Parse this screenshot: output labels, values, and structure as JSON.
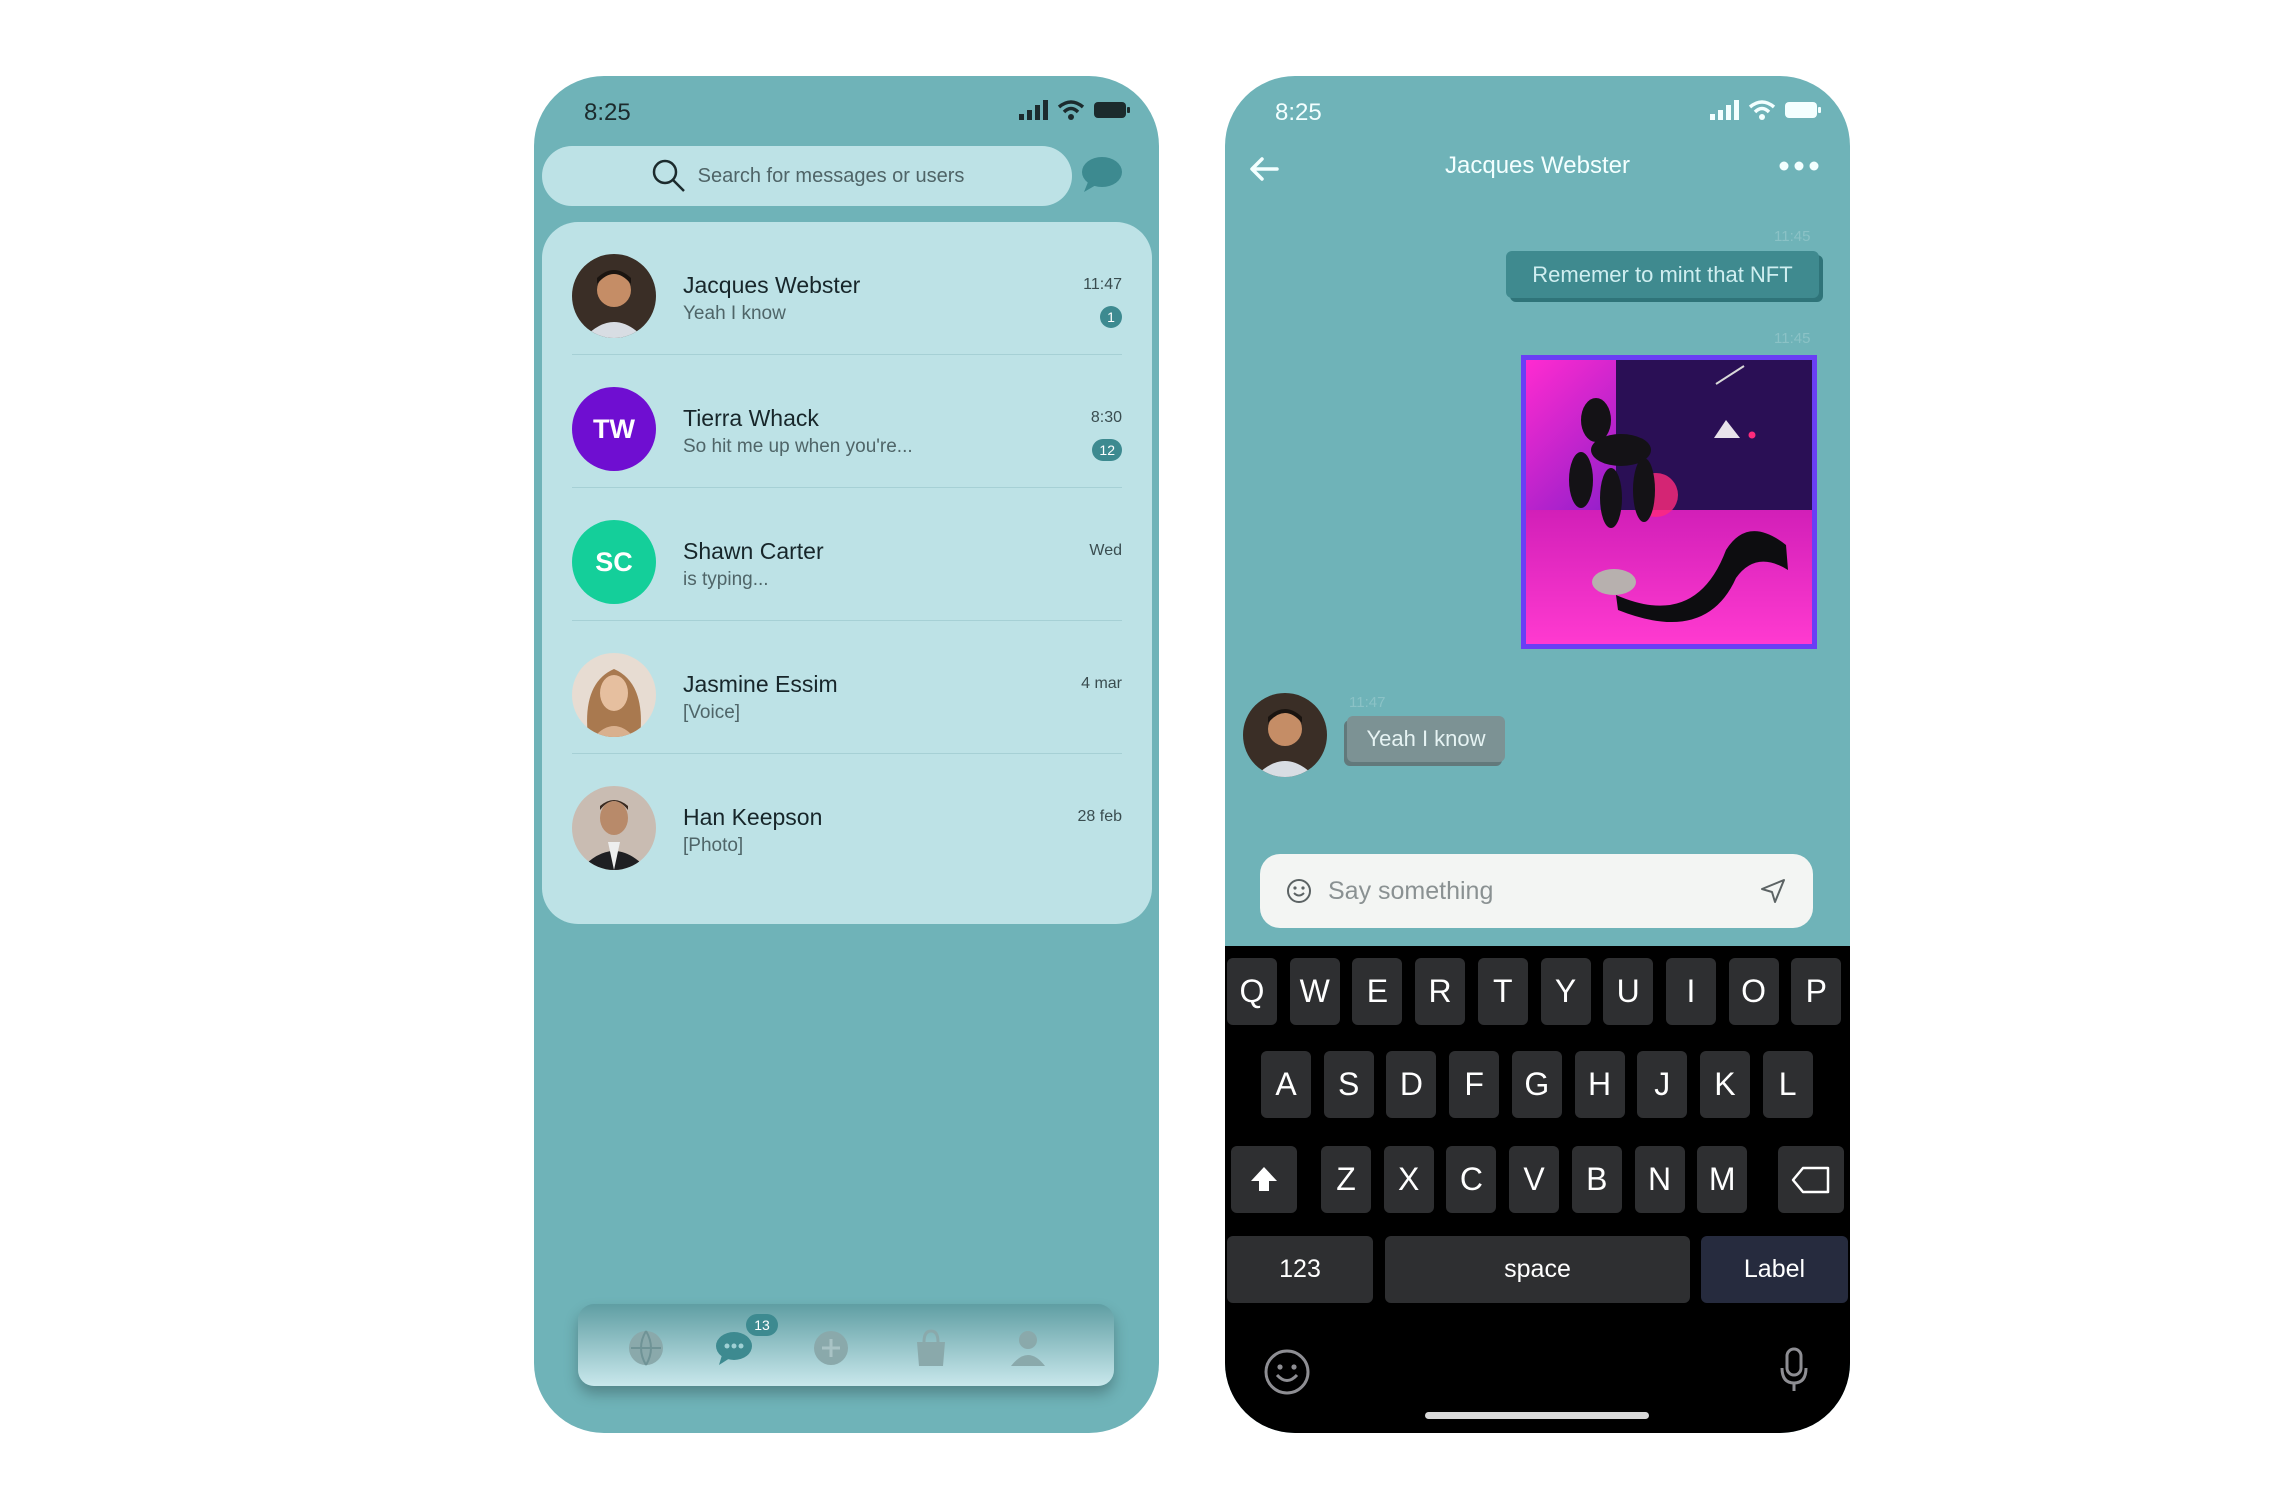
{
  "colors": {
    "teal": "#6fb3b8",
    "panel": "#bde2e6",
    "badge": "#3d8a90",
    "nft_border": "#6a3ef5"
  },
  "left": {
    "status": {
      "time": "8:25"
    },
    "search": {
      "placeholder": "Search for messages or users",
      "icon": "search-icon"
    },
    "chats": [
      {
        "name": "Jacques Webster",
        "message": "Yeah I know",
        "time": "11:47",
        "badge": "1",
        "avatar_type": "photo"
      },
      {
        "name": "Tierra Whack",
        "message": "So hit me up when you're...",
        "time": "8:30",
        "badge": "12",
        "initials": "TW",
        "avatar_color": "#6f0ed1"
      },
      {
        "name": "Shawn Carter",
        "message": "is typing...",
        "time": "Wed",
        "initials": "SC",
        "avatar_color": "#14cf9a"
      },
      {
        "name": "Jasmine Essim",
        "message": "[Voice]",
        "time": "4 mar",
        "avatar_type": "photo"
      },
      {
        "name": "Han Keepson",
        "message": "[Photo]",
        "time": "28 feb",
        "avatar_type": "photo"
      }
    ],
    "tabbar": {
      "chat_badge": "13",
      "icons": [
        "globe-icon",
        "chat-icon",
        "add-icon",
        "bag-icon",
        "profile-icon"
      ]
    }
  },
  "right": {
    "status": {
      "time": "8:25"
    },
    "header": {
      "title": "Jacques Webster"
    },
    "messages": [
      {
        "time": "11:45",
        "text": "Rememer to mint that NFT",
        "direction": "out"
      },
      {
        "time": "11:45",
        "type": "image",
        "direction": "out"
      },
      {
        "time": "11:47",
        "text": "Yeah I know",
        "direction": "in"
      }
    ],
    "composer": {
      "placeholder": "Say something"
    },
    "keyboard": {
      "row1": [
        "Q",
        "W",
        "E",
        "R",
        "T",
        "Y",
        "U",
        "I",
        "O",
        "P"
      ],
      "row2": [
        "A",
        "S",
        "D",
        "F",
        "G",
        "H",
        "J",
        "K",
        "L"
      ],
      "row3": [
        "Z",
        "X",
        "C",
        "V",
        "B",
        "N",
        "M"
      ],
      "numbers": "123",
      "space": "space",
      "action": "Label"
    }
  }
}
